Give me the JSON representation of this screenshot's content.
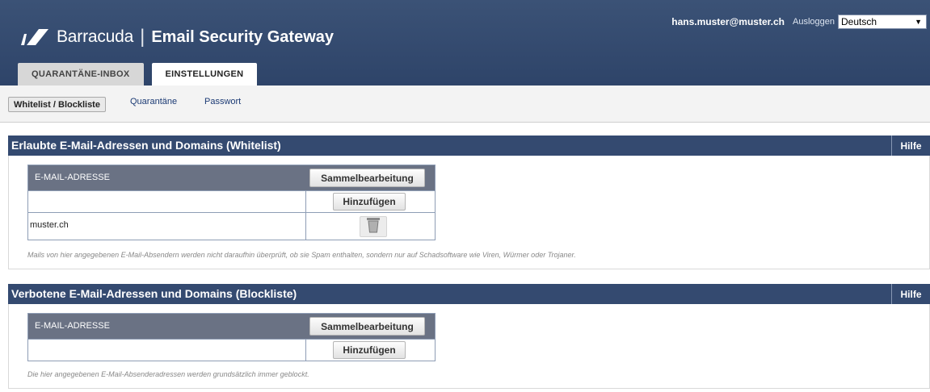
{
  "header": {
    "brand": "Barracuda",
    "separator": "|",
    "product": "Email Security Gateway",
    "user_email": "hans.muster@muster.ch",
    "logout_label": "Ausloggen",
    "language": "Deutsch"
  },
  "tabs": [
    {
      "label": "QUARANTÄNE-INBOX",
      "active": false
    },
    {
      "label": "EINSTELLUNGEN",
      "active": true
    }
  ],
  "subnav": [
    {
      "label": "Whitelist / Blockliste",
      "active": true
    },
    {
      "label": "Quarantäne",
      "active": false
    },
    {
      "label": "Passwort",
      "active": false
    }
  ],
  "whitelist": {
    "title": "Erlaubte E-Mail-Adressen und Domains (Whitelist)",
    "help_label": "Hilfe",
    "column_header": "E-MAIL-ADRESSE",
    "bulk_edit_label": "Sammelbearbeitung",
    "add_label": "Hinzufügen",
    "new_entry_value": "",
    "entries": [
      "muster.ch"
    ],
    "note": "Mails von hier angegebenen E-Mail-Absendern werden nicht daraufhin überprüft, ob sie Spam enthalten, sondern nur auf Schadsoftware wie Viren, Würmer oder Trojaner."
  },
  "blocklist": {
    "title": "Verbotene E-Mail-Adressen und Domains (Blockliste)",
    "help_label": "Hilfe",
    "column_header": "E-MAIL-ADRESSE",
    "bulk_edit_label": "Sammelbearbeitung",
    "add_label": "Hinzufügen",
    "new_entry_value": "",
    "entries": [],
    "note": "Die hier angegebenen E-Mail-Absenderadressen werden grundsätzlich immer geblockt."
  },
  "icons": {
    "logo": "barracuda-logo-icon",
    "delete": "trash-icon",
    "dropdown": "chevron-down-icon"
  },
  "colors": {
    "header_bg": "#2e4469",
    "section_header_bg": "#344a70",
    "table_header_bg": "#6a7284",
    "link": "#1b3a74"
  }
}
